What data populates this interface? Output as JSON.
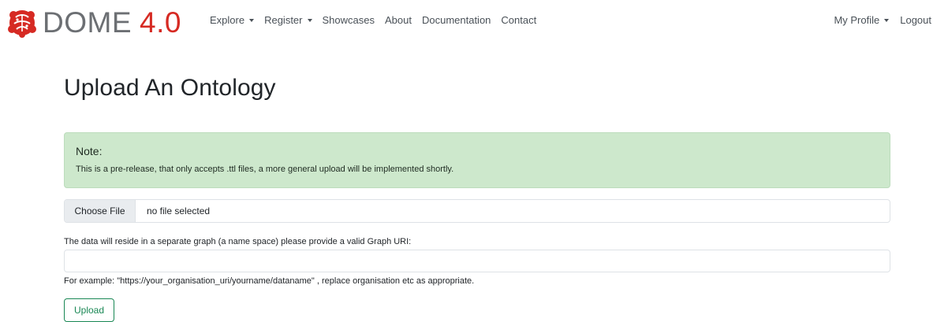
{
  "brand": {
    "logo_icon": "brain-logo-icon",
    "name": "DOME",
    "version": "4.0",
    "colors": {
      "name": "#6c6f73",
      "version": "#d62a23",
      "logo": "#d62a23"
    }
  },
  "nav": {
    "items": [
      {
        "label": "Explore",
        "dropdown": true
      },
      {
        "label": "Register",
        "dropdown": true
      },
      {
        "label": "Showcases",
        "dropdown": false
      },
      {
        "label": "About",
        "dropdown": false
      },
      {
        "label": "Documentation",
        "dropdown": false
      },
      {
        "label": "Contact",
        "dropdown": false
      }
    ],
    "profile_label": "My Profile",
    "logout_label": "Logout"
  },
  "page": {
    "title": "Upload An Ontology"
  },
  "note": {
    "heading": "Note:",
    "text": "This is a pre-release, that only accepts .ttl files, a more general upload will be implemented shortly.",
    "background": "#cde8cc"
  },
  "file_upload": {
    "button_label": "Choose File",
    "status": "no file selected"
  },
  "graph": {
    "label": "The data will reside in a separate graph (a name space) please provide a valid Graph URI:",
    "value": "",
    "example": "For example: \"https://your_organisation_uri/yourname/dataname\" , replace organisation etc as appropriate."
  },
  "upload": {
    "label": "Upload",
    "color": "#198754"
  }
}
